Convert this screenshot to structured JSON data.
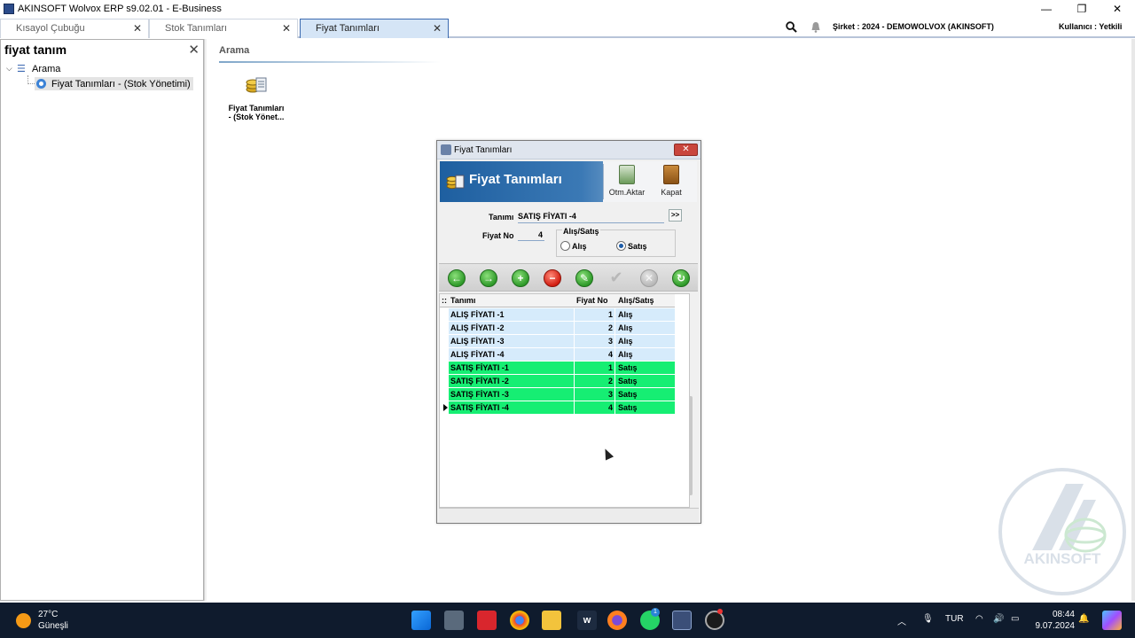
{
  "window": {
    "title": "AKINSOFT Wolvox ERP s9.02.01 - E-Business",
    "minimize": "—",
    "maximize": "❐",
    "close": "✕"
  },
  "tabs": [
    {
      "label": "Kısayol Çubuğu",
      "close": "✕"
    },
    {
      "label": "Stok Tanımları",
      "close": "✕"
    },
    {
      "label": "Fiyat Tanımları",
      "close": "✕"
    }
  ],
  "header_right": {
    "company": "Şirket : 2024 - DEMOWOLVOX (AKINSOFT)",
    "user": "Kullanıcı : Yetkili"
  },
  "left_panel": {
    "search_text": "fiyat tanım",
    "close": "✕",
    "tree_root": "Arama",
    "tree_child": "Fiyat Tanımları - (Stok Yönetimi)"
  },
  "main": {
    "heading": "Arama",
    "shortcut_label_1": "Fiyat Tanımları",
    "shortcut_label_2": "- (Stok Yönet..."
  },
  "dialog": {
    "title": "Fiyat Tanımları",
    "close": "✕",
    "header_title": "Fiyat Tanımları",
    "btn_otm": "Otm.Aktar",
    "btn_kapat": "Kapat",
    "form": {
      "tanimi_label": "Tanımı",
      "tanimi_value": "SATIŞ FİYATI -4",
      "more_btn": ">>",
      "fiyatno_label": "Fiyat No",
      "fiyatno_value": "4",
      "group_title": "Alış/Satış",
      "radio_alis": "Alış",
      "radio_satis": "Satış",
      "selected": "Satış"
    },
    "nav_buttons": [
      "←",
      "→",
      "+",
      "−",
      "✎",
      "✔",
      "✕",
      "↻"
    ],
    "grid": {
      "header_marker": "::",
      "columns": [
        "Tanımı",
        "Fiyat No",
        "Alış/Satış"
      ],
      "rows": [
        {
          "tanimi": "ALIŞ FİYATI -1",
          "no": "1",
          "tur": "Alış"
        },
        {
          "tanimi": "ALIŞ FİYATI -2",
          "no": "2",
          "tur": "Alış"
        },
        {
          "tanimi": "ALIŞ FİYATI -3",
          "no": "3",
          "tur": "Alış"
        },
        {
          "tanimi": "ALIŞ FİYATI -4",
          "no": "4",
          "tur": "Alış"
        },
        {
          "tanimi": "SATIŞ FİYATI -1",
          "no": "1",
          "tur": "Satış"
        },
        {
          "tanimi": "SATIŞ FİYATI -2",
          "no": "2",
          "tur": "Satış"
        },
        {
          "tanimi": "SATIŞ FİYATI -3",
          "no": "3",
          "tur": "Satış"
        },
        {
          "tanimi": "SATIŞ FİYATI -4",
          "no": "4",
          "tur": "Satış"
        }
      ]
    }
  },
  "watermark": "AKINSOFT",
  "taskbar": {
    "temperature": "27°C",
    "weather": "Güneşli",
    "language": "TUR",
    "time": "08:44",
    "date": "9.07.2024",
    "whatsapp_badge": "1"
  },
  "colors": {
    "alis_row": "#d6ebfb",
    "satis_row": "#16ee73",
    "taskbar": "#0f1b2d",
    "dialog_header": "#1e5fa0"
  }
}
